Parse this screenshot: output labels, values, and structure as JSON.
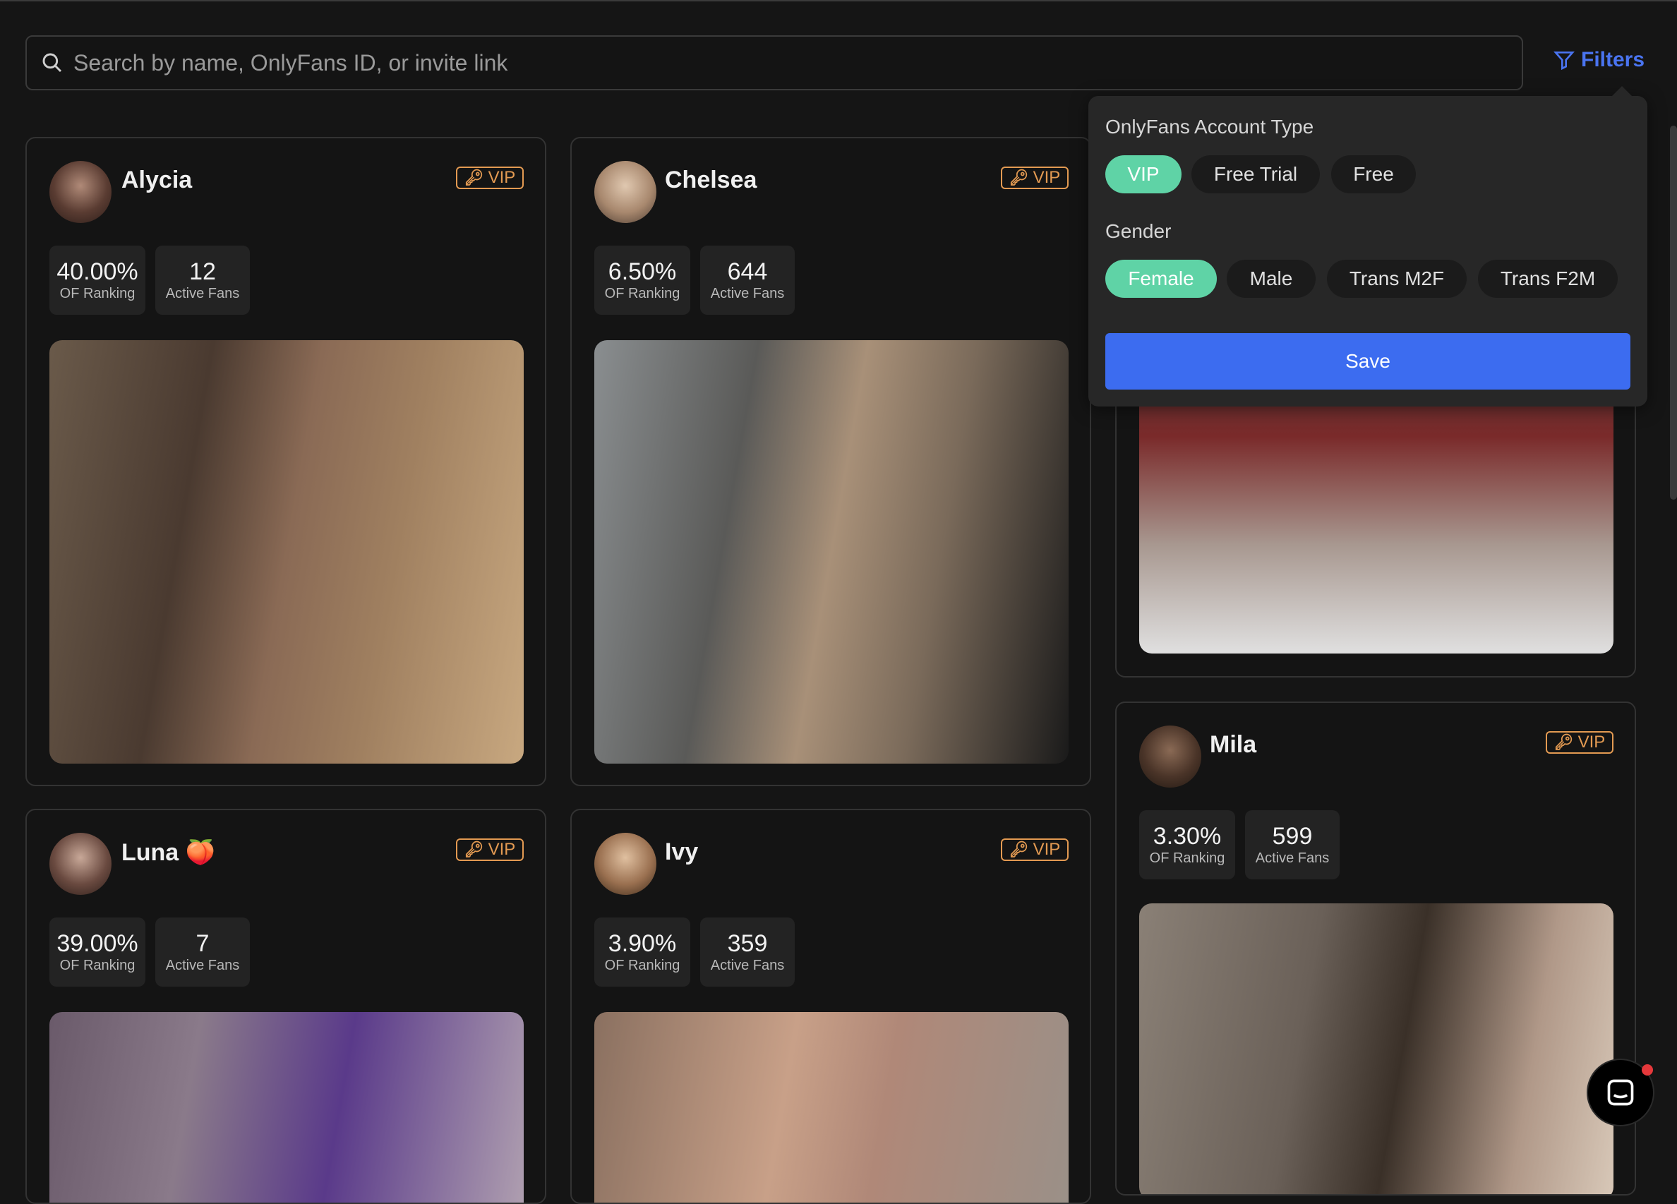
{
  "search": {
    "placeholder": "Search by name, OnlyFans ID, or invite link"
  },
  "filters_label": "Filters",
  "vip_label": "VIP",
  "stat_labels": {
    "ranking": "OF Ranking",
    "fans": "Active Fans"
  },
  "cards": [
    {
      "name": "Alycia",
      "ranking": "40.00%",
      "fans": "12"
    },
    {
      "name": "Chelsea",
      "ranking": "6.50%",
      "fans": "644"
    },
    {
      "name": "Mila",
      "ranking": "3.30%",
      "fans": "599"
    },
    {
      "name": "Luna 🍑",
      "ranking": "39.00%",
      "fans": "7"
    },
    {
      "name": "Ivy",
      "ranking": "3.90%",
      "fans": "359"
    }
  ],
  "filter_panel": {
    "account_type_title": "OnlyFans Account Type",
    "account_types": [
      "VIP",
      "Free Trial",
      "Free"
    ],
    "account_type_selected": "VIP",
    "gender_title": "Gender",
    "genders": [
      "Female",
      "Male",
      "Trans M2F",
      "Trans F2M"
    ],
    "gender_selected": "Female",
    "save_label": "Save"
  },
  "colors": {
    "accent_blue": "#3c6cf0",
    "chip_active": "#5fd3a6",
    "vip_orange": "#e39a52"
  }
}
